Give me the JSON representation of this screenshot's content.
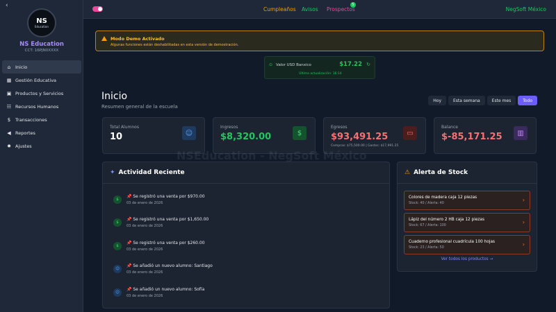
{
  "sidebar": {
    "logo": {
      "line1": "NS",
      "line2": "Education"
    },
    "school_name": "NS Education",
    "cct": "CCT: 16PJN0XXXX",
    "items": [
      {
        "label": "Inicio",
        "icon": "home-icon",
        "active": true
      },
      {
        "label": "Gestión Educativa",
        "icon": "graduation-cap-icon"
      },
      {
        "label": "Productos y Servicios",
        "icon": "box-icon"
      },
      {
        "label": "Recursos Humanos",
        "icon": "users-icon"
      },
      {
        "label": "Transacciones",
        "icon": "dollar-icon"
      },
      {
        "label": "Reportes",
        "icon": "megaphone-icon"
      },
      {
        "label": "Ajustes",
        "icon": "gear-icon"
      }
    ]
  },
  "topbar": {
    "links": {
      "cumpleanos": "Cumpleaños",
      "avisos": "Avisos",
      "prospectos": "Prospectos"
    },
    "prospectos_badge": "5",
    "company": "NegSoft México"
  },
  "demo_banner": {
    "title": "Modo Demo Activado",
    "text": "Algunas funciones están deshabilitadas en esta versión de demostración."
  },
  "usd": {
    "label": "Valor USD Banxico",
    "value": "$17.22",
    "updated": "Última actualización: 16:14"
  },
  "page": {
    "title": "Inicio",
    "subtitle": "Resumen general de la escuela"
  },
  "filters": [
    "Hoy",
    "Esta semana",
    "Este mes",
    "Todo"
  ],
  "active_filter": "Todo",
  "stats": [
    {
      "label": "Total Alumnos",
      "value": "10",
      "note": "",
      "color": "#ffffff",
      "icon": "users-icon"
    },
    {
      "label": "Ingresos",
      "value": "$8,320.00",
      "note": "",
      "color": "#22c55e",
      "icon": "dollar-icon"
    },
    {
      "label": "Egresos",
      "value": "$93,491.25",
      "note": "Compras: $75,500.00 | Gastos: $17,991.25",
      "color": "#f87171",
      "icon": "credit-card-icon"
    },
    {
      "label": "Balance",
      "value": "$-85,171.25",
      "note": "",
      "color": "#f87171",
      "icon": "bar-chart-icon"
    }
  ],
  "watermark": "NSEducation - NegSoft México",
  "activity": {
    "title": "Actividad Reciente",
    "items": [
      {
        "text": "📌 Se registró una venta por $970.00",
        "date": "03 de enero de 2026",
        "type": "sale"
      },
      {
        "text": "📌 Se registró una venta por $1,650.00",
        "date": "03 de enero de 2026",
        "type": "sale"
      },
      {
        "text": "📌 Se registró una venta por $260.00",
        "date": "03 de enero de 2026",
        "type": "sale"
      },
      {
        "text": "📌 Se añadió un nuevo alumno: Santiago",
        "date": "03 de enero de 2026",
        "type": "student"
      },
      {
        "text": "📌 Se añadió un nuevo alumno: Sofía",
        "date": "03 de enero de 2026",
        "type": "student"
      }
    ]
  },
  "stock": {
    "title": "Alerta de Stock",
    "items": [
      {
        "name": "Colores de madera caja 12 piezas",
        "meta": "Stock: 40 / Alerta: 40"
      },
      {
        "name": "Lápiz del número 2 HB caja 12 piezas",
        "meta": "Stock: 67 / Alerta: 100"
      },
      {
        "name": "Cuaderno profesional cuadrícula 100 hojas",
        "meta": "Stock: 23 / Alerta: 50"
      }
    ],
    "link": "Ver todos los productos →"
  }
}
